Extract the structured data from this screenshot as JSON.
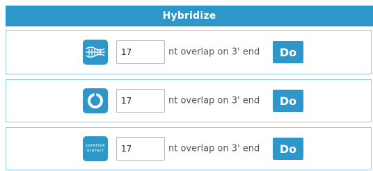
{
  "header": {
    "title": "Hybridize"
  },
  "rows": [
    {
      "icon": "double-strand-dna-icon",
      "overlap_value": "17",
      "label": "nt overlap on 3' end",
      "button": "Do"
    },
    {
      "icon": "circular-plasmid-icon",
      "overlap_value": "17",
      "label": "nt overlap on 3' end",
      "button": "Do"
    },
    {
      "icon": "sequence-text-icon",
      "icon_text_line1": "CGTATCGA",
      "icon_text_line2": "GCATGCT",
      "overlap_value": "17",
      "label": "nt overlap on 3' end",
      "button": "Do"
    }
  ],
  "colors": {
    "accent": "#2e97c9",
    "row_border": "#8fcae6",
    "label_text": "#555555"
  }
}
